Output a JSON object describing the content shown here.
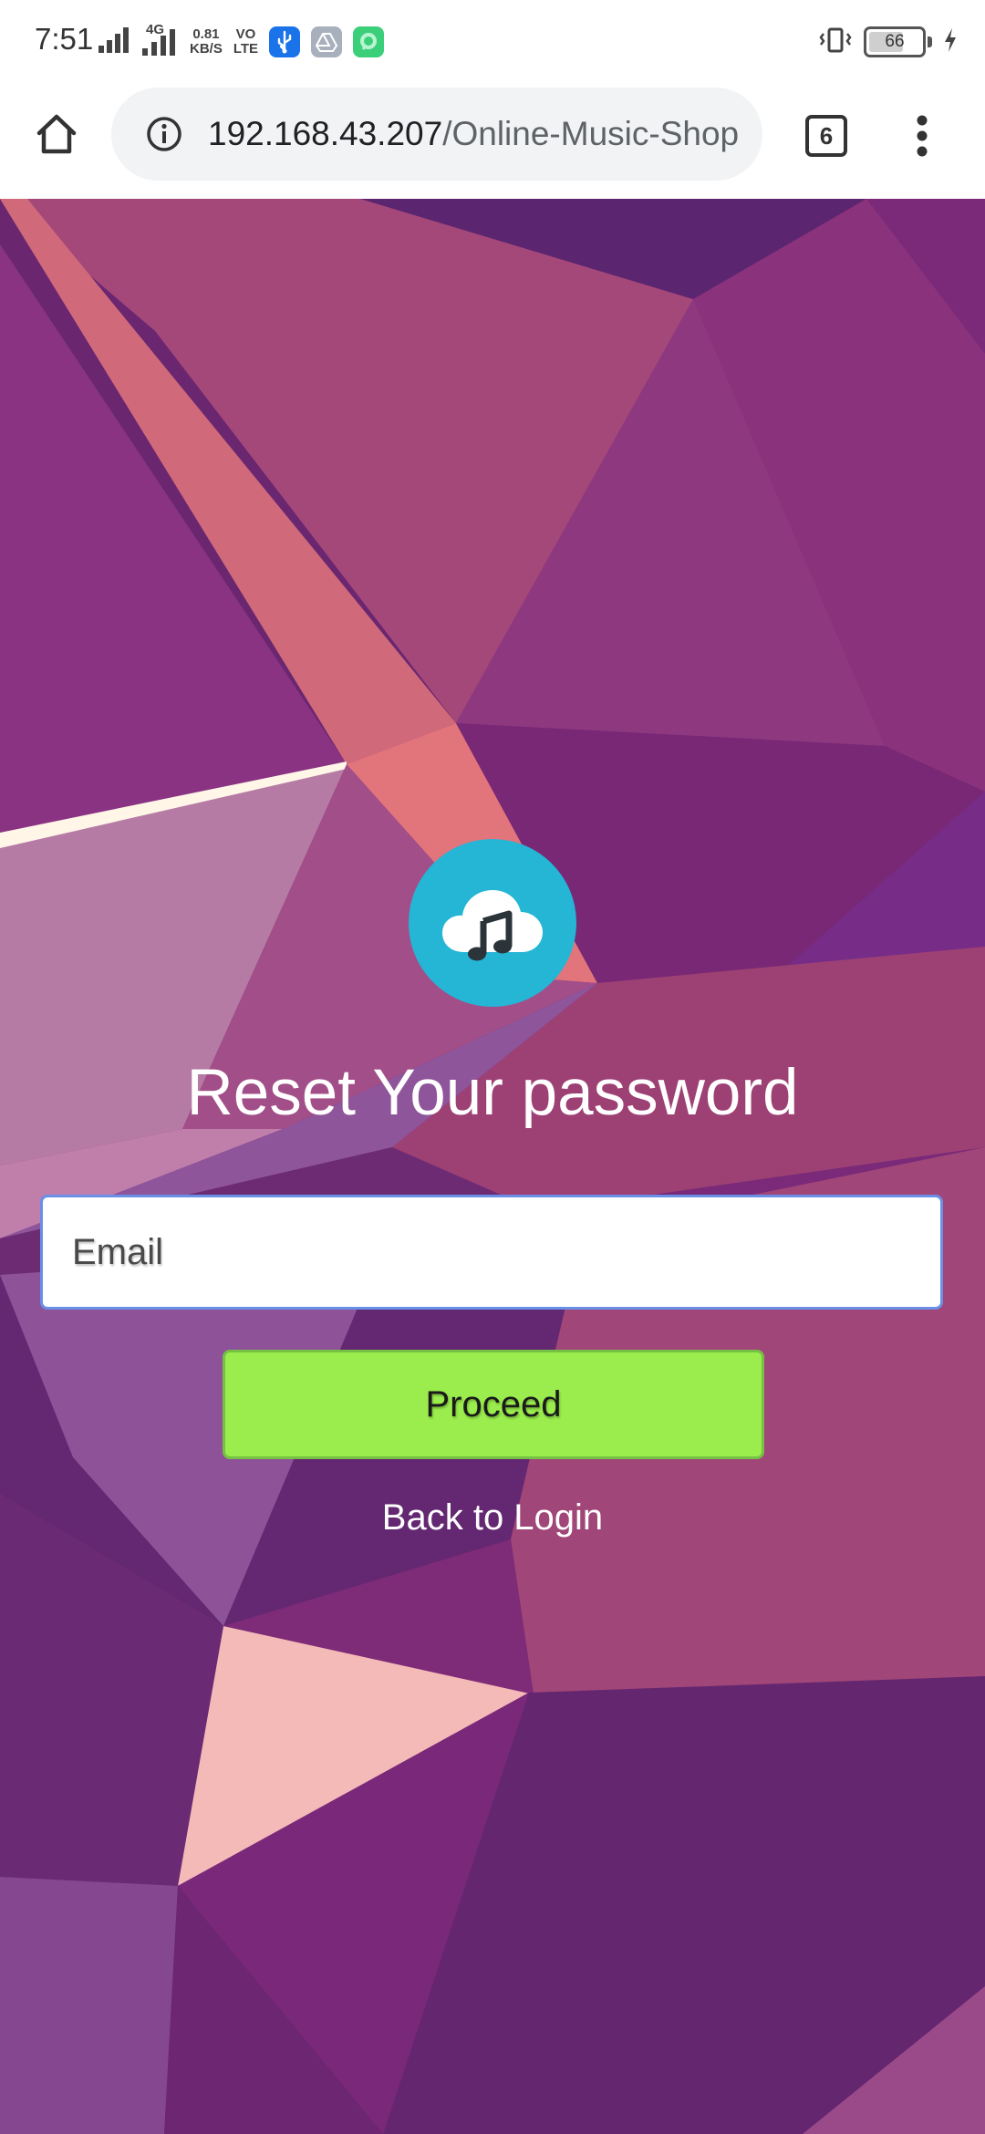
{
  "status_bar": {
    "time": "7:51",
    "network_type": "4G",
    "data_speed_value": "0.81",
    "data_speed_unit": "KB/S",
    "volte_top": "VO",
    "volte_bottom": "LTE",
    "battery_level": "66",
    "battery_fraction": 0.66,
    "notification_icons": [
      "signal-icon",
      "signal-icon",
      "usb-icon",
      "drive-icon",
      "chat-icon"
    ]
  },
  "browser": {
    "url_host": "192.168.43.207",
    "url_path": "/Online-Music-Shop",
    "tab_count": "6"
  },
  "page": {
    "logo_icon": "cloud-music-icon",
    "title": "Reset Your password",
    "email_placeholder": "Email",
    "proceed_label": "Proceed",
    "back_label": "Back to Login"
  },
  "colors": {
    "logo_circle": "#25b5d5",
    "proceed_button": "#9aed4c",
    "input_border": "#6a8fe6",
    "background_base": "#7a2a78"
  }
}
